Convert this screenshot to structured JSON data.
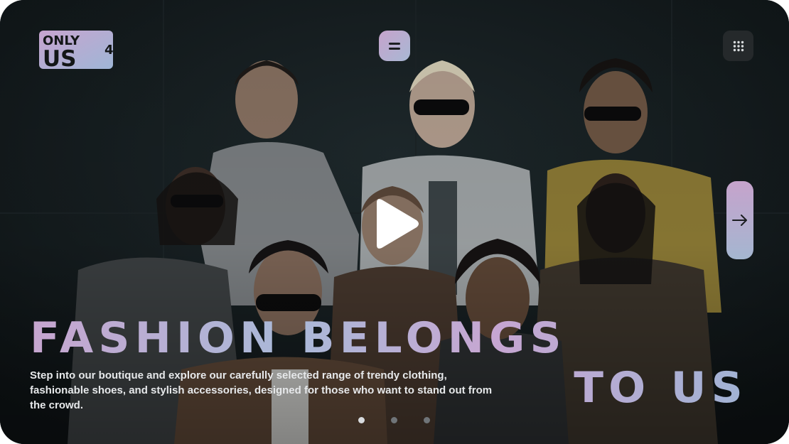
{
  "brand": {
    "logo_line1": "ONLY",
    "logo_line2": "US",
    "logo_number": "4"
  },
  "header": {
    "menu_icon": "equals-icon",
    "apps_icon": "grid-dots-icon"
  },
  "hero": {
    "headline_line1": "FASHION BELONGS",
    "headline_line2": "TO US",
    "description": "Step into our boutique and explore our carefully selected range of trendy clothing, fashionable shoes, and stylish accessories, designed for those who want to stand out from the crowd.",
    "play_icon": "play-icon",
    "next_icon": "arrow-right-icon"
  },
  "carousel": {
    "slide_count": 3,
    "active_index": 0
  },
  "colors": {
    "accent_pink": "#c6a3cc",
    "accent_blue": "#a8b8d4",
    "background": "#141a1c"
  }
}
